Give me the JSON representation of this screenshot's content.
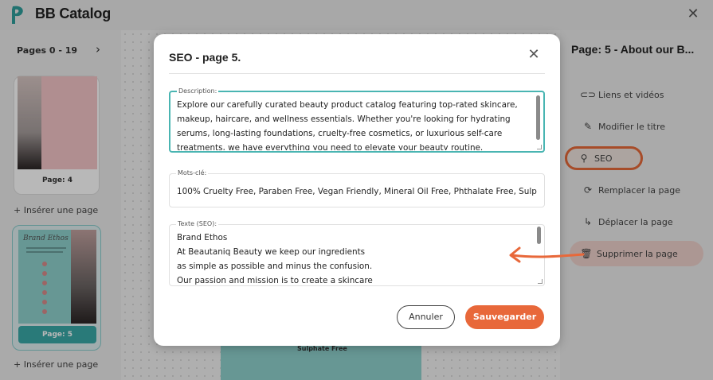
{
  "app": {
    "title": "BB Catalog",
    "close_icon": "close-icon"
  },
  "left_panel": {
    "pages_range": "Pages 0 - 19",
    "next_icon": "chevron-right-icon",
    "pages": [
      {
        "label": "Page: 4"
      },
      {
        "label": "Page: 5",
        "thumb_title": "Brand Ethos"
      }
    ],
    "insert_label": "+ Insérer une page"
  },
  "canvas": {
    "visible_text": "Sulphate Free"
  },
  "right_panel": {
    "title": "Page: 5 - About our B...",
    "items": [
      {
        "label": "Liens et vidéos",
        "icon": "link-icon"
      },
      {
        "label": "Modifier le titre",
        "icon": "pencil-icon"
      },
      {
        "label": "SEO",
        "icon": "search-icon"
      },
      {
        "label": "Remplacer la page",
        "icon": "refresh-icon"
      },
      {
        "label": "Déplacer la page",
        "icon": "move-icon"
      },
      {
        "label": "Supprimer la page",
        "icon": "trash-icon"
      }
    ]
  },
  "modal": {
    "title": "SEO - page 5.",
    "description_label": "Description:",
    "description_value": "Explore our carefully curated beauty product catalog featuring top-rated skincare, makeup, haircare, and wellness essentials. Whether you're looking for hydrating serums, long-lasting foundations, cruelty-free cosmetics, or luxurious self-care treatments, we have everything you need to elevate your beauty routine.",
    "keywords_label": "Mots-clé:",
    "keywords_value": "100% Cruelty Free, Paraben Free, Vegan Friendly, Mineral Oil Free, Phthalate Free, Sulphate Free",
    "seo_text_label": "Texte (SEO):",
    "seo_text_value": "Brand Ethos\nAt Beautaniq Beauty we keep our ingredients\nas simple as possible and minus the confusion.\nOur passion and mission is to create a skincare",
    "cancel_label": "Annuler",
    "save_label": "Sauvegarder"
  },
  "colors": {
    "accent": "#e8683a",
    "teal": "#49b5b2"
  }
}
